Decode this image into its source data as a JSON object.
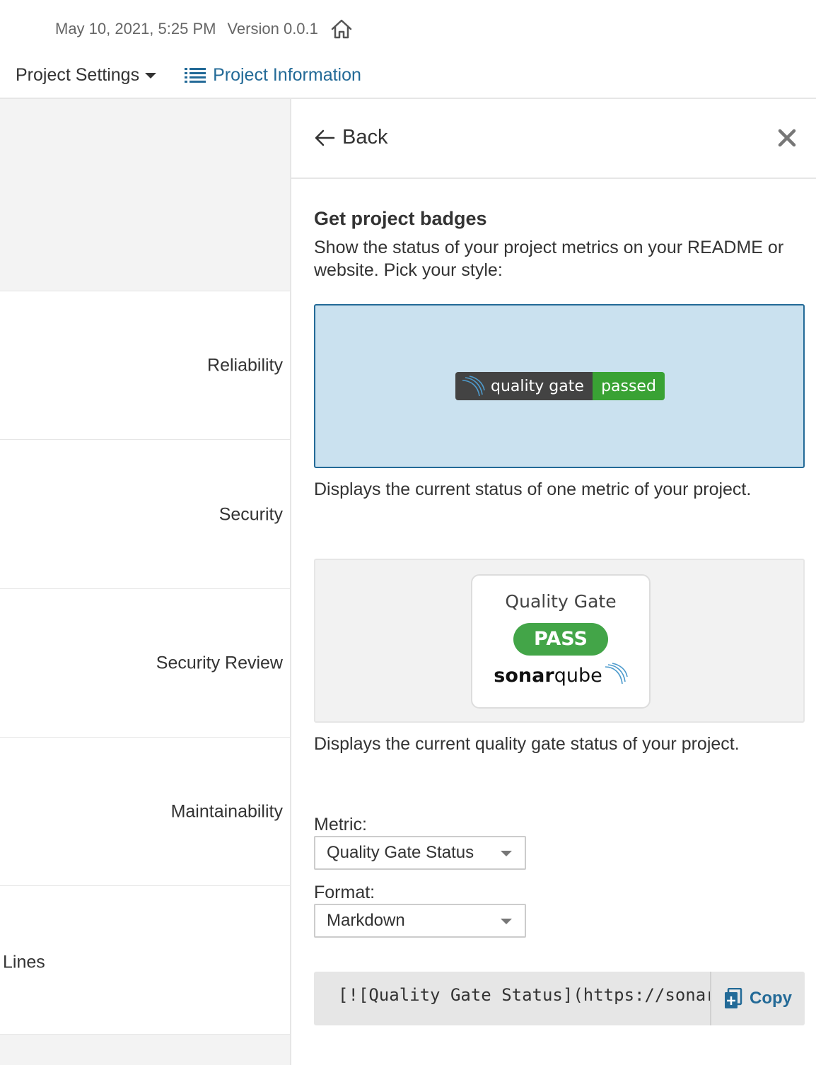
{
  "meta": {
    "datetime": "May 10, 2021, 5:25 PM",
    "version": "Version 0.0.1"
  },
  "nav": {
    "project_settings": "Project Settings",
    "project_information": "Project Information"
  },
  "left_rows": {
    "reliability": "Reliability",
    "security": "Security",
    "security_review": "Security Review",
    "maintainability": "Maintainability",
    "lines": "Lines"
  },
  "panel": {
    "back_label": "Back",
    "title": "Get project badges",
    "description": "Show the status of your project metrics on your README or website. Pick your style:",
    "badge_options": [
      {
        "badge_label": "quality gate",
        "badge_value": "passed",
        "caption": "Displays the current status of one metric of your project.",
        "selected": true
      },
      {
        "card_title": "Quality Gate",
        "card_status": "PASS",
        "logo_text_bold": "sonar",
        "logo_text_regular": "qube",
        "caption": "Displays the current quality gate status of your project.",
        "selected": false
      }
    ],
    "metric_label": "Metric:",
    "metric_value": "Quality Gate Status",
    "format_label": "Format:",
    "format_value": "Markdown",
    "code_snippet": "[![Quality Gate Status](https://sonar",
    "copy_label": "Copy"
  },
  "colors": {
    "link_blue": "#236a97",
    "selected_bg": "#cae1ef",
    "badge_green": "#39a234",
    "pass_green": "#43a548"
  },
  "icons": {
    "home": "home-icon",
    "caret": "caret-down-icon",
    "list": "list-icon",
    "back": "arrow-left-icon",
    "close": "close-icon",
    "copy": "clipboard-icon"
  }
}
